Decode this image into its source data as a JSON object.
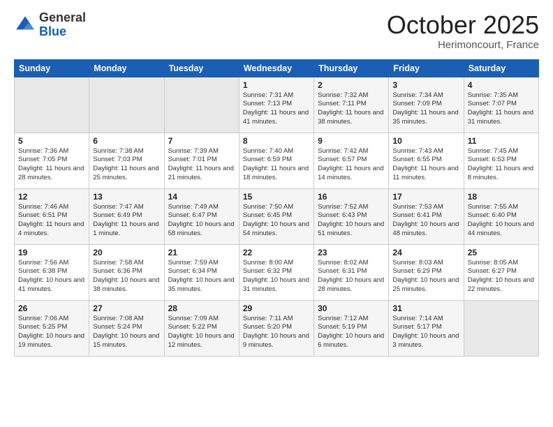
{
  "logo": {
    "general": "General",
    "blue": "Blue"
  },
  "title": "October 2025",
  "location": "Herimoncourt, France",
  "days_header": [
    "Sunday",
    "Monday",
    "Tuesday",
    "Wednesday",
    "Thursday",
    "Friday",
    "Saturday"
  ],
  "weeks": [
    [
      {
        "day": "",
        "info": ""
      },
      {
        "day": "",
        "info": ""
      },
      {
        "day": "",
        "info": ""
      },
      {
        "day": "1",
        "info": "Sunrise: 7:31 AM\nSunset: 7:13 PM\nDaylight: 11 hours and 41 minutes."
      },
      {
        "day": "2",
        "info": "Sunrise: 7:32 AM\nSunset: 7:11 PM\nDaylight: 11 hours and 38 minutes."
      },
      {
        "day": "3",
        "info": "Sunrise: 7:34 AM\nSunset: 7:09 PM\nDaylight: 11 hours and 35 minutes."
      },
      {
        "day": "4",
        "info": "Sunrise: 7:35 AM\nSunset: 7:07 PM\nDaylight: 11 hours and 31 minutes."
      }
    ],
    [
      {
        "day": "5",
        "info": "Sunrise: 7:36 AM\nSunset: 7:05 PM\nDaylight: 11 hours and 28 minutes."
      },
      {
        "day": "6",
        "info": "Sunrise: 7:38 AM\nSunset: 7:03 PM\nDaylight: 11 hours and 25 minutes."
      },
      {
        "day": "7",
        "info": "Sunrise: 7:39 AM\nSunset: 7:01 PM\nDaylight: 11 hours and 21 minutes."
      },
      {
        "day": "8",
        "info": "Sunrise: 7:40 AM\nSunset: 6:59 PM\nDaylight: 11 hours and 18 minutes."
      },
      {
        "day": "9",
        "info": "Sunrise: 7:42 AM\nSunset: 6:57 PM\nDaylight: 11 hours and 14 minutes."
      },
      {
        "day": "10",
        "info": "Sunrise: 7:43 AM\nSunset: 6:55 PM\nDaylight: 11 hours and 11 minutes."
      },
      {
        "day": "11",
        "info": "Sunrise: 7:45 AM\nSunset: 6:53 PM\nDaylight: 11 hours and 8 minutes."
      }
    ],
    [
      {
        "day": "12",
        "info": "Sunrise: 7:46 AM\nSunset: 6:51 PM\nDaylight: 11 hours and 4 minutes."
      },
      {
        "day": "13",
        "info": "Sunrise: 7:47 AM\nSunset: 6:49 PM\nDaylight: 11 hours and 1 minute."
      },
      {
        "day": "14",
        "info": "Sunrise: 7:49 AM\nSunset: 6:47 PM\nDaylight: 10 hours and 58 minutes."
      },
      {
        "day": "15",
        "info": "Sunrise: 7:50 AM\nSunset: 6:45 PM\nDaylight: 10 hours and 54 minutes."
      },
      {
        "day": "16",
        "info": "Sunrise: 7:52 AM\nSunset: 6:43 PM\nDaylight: 10 hours and 51 minutes."
      },
      {
        "day": "17",
        "info": "Sunrise: 7:53 AM\nSunset: 6:41 PM\nDaylight: 10 hours and 48 minutes."
      },
      {
        "day": "18",
        "info": "Sunrise: 7:55 AM\nSunset: 6:40 PM\nDaylight: 10 hours and 44 minutes."
      }
    ],
    [
      {
        "day": "19",
        "info": "Sunrise: 7:56 AM\nSunset: 6:38 PM\nDaylight: 10 hours and 41 minutes."
      },
      {
        "day": "20",
        "info": "Sunrise: 7:58 AM\nSunset: 6:36 PM\nDaylight: 10 hours and 38 minutes."
      },
      {
        "day": "21",
        "info": "Sunrise: 7:59 AM\nSunset: 6:34 PM\nDaylight: 10 hours and 35 minutes."
      },
      {
        "day": "22",
        "info": "Sunrise: 8:00 AM\nSunset: 6:32 PM\nDaylight: 10 hours and 31 minutes."
      },
      {
        "day": "23",
        "info": "Sunrise: 8:02 AM\nSunset: 6:31 PM\nDaylight: 10 hours and 28 minutes."
      },
      {
        "day": "24",
        "info": "Sunrise: 8:03 AM\nSunset: 6:29 PM\nDaylight: 10 hours and 25 minutes."
      },
      {
        "day": "25",
        "info": "Sunrise: 8:05 AM\nSunset: 6:27 PM\nDaylight: 10 hours and 22 minutes."
      }
    ],
    [
      {
        "day": "26",
        "info": "Sunrise: 7:06 AM\nSunset: 5:25 PM\nDaylight: 10 hours and 19 minutes."
      },
      {
        "day": "27",
        "info": "Sunrise: 7:08 AM\nSunset: 5:24 PM\nDaylight: 10 hours and 15 minutes."
      },
      {
        "day": "28",
        "info": "Sunrise: 7:09 AM\nSunset: 5:22 PM\nDaylight: 10 hours and 12 minutes."
      },
      {
        "day": "29",
        "info": "Sunrise: 7:11 AM\nSunset: 5:20 PM\nDaylight: 10 hours and 9 minutes."
      },
      {
        "day": "30",
        "info": "Sunrise: 7:12 AM\nSunset: 5:19 PM\nDaylight: 10 hours and 6 minutes."
      },
      {
        "day": "31",
        "info": "Sunrise: 7:14 AM\nSunset: 5:17 PM\nDaylight: 10 hours and 3 minutes."
      },
      {
        "day": "",
        "info": ""
      }
    ]
  ]
}
